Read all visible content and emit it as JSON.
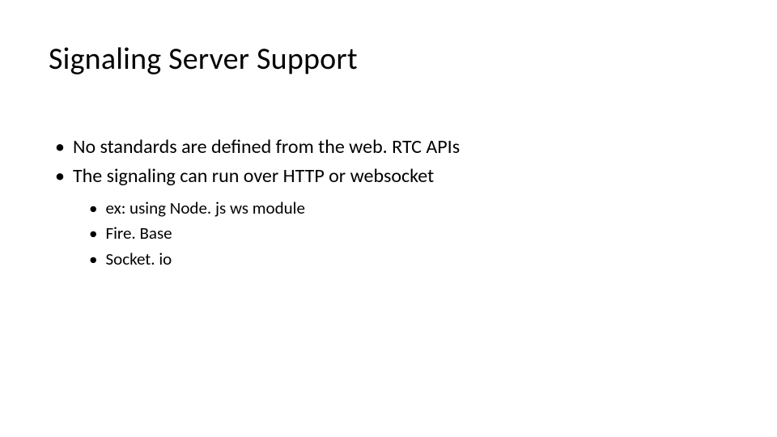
{
  "slide": {
    "title": "Signaling Server Support",
    "bullets": [
      {
        "text": "No standards are defined from the web. RTC APIs",
        "children": []
      },
      {
        "text": "The signaling can run over HTTP or websocket",
        "children": [
          {
            "text": "ex: using Node. js ws module"
          },
          {
            "text": "Fire. Base"
          },
          {
            "text": "Socket. io"
          }
        ]
      }
    ]
  }
}
